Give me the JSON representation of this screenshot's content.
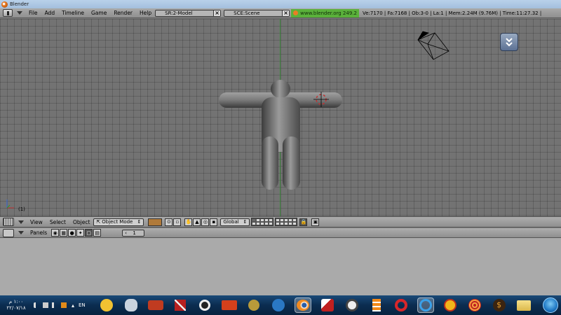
{
  "window": {
    "title": "Blender"
  },
  "info_header": {
    "menus": [
      "File",
      "Add",
      "Timeline",
      "Game",
      "Render",
      "Help"
    ],
    "screen_field": "SR:2-Model",
    "scene_field": "SCE:Scene",
    "url": "www.blender.org 249.2",
    "stats": "Ve:7170 | Fa:7168 | Ob:3-0 | La:1 | Mem:2.24M (9.76M) | Time:11:27.32 |"
  },
  "viewport": {
    "frame": "(1)",
    "grid_color": "#737373",
    "model_color": "#6e6e6e"
  },
  "view_header": {
    "menus": [
      "View",
      "Select",
      "Object"
    ],
    "mode": "Object Mode",
    "orientation": "Global"
  },
  "buttons_header": {
    "label": "Panels",
    "page": "1"
  },
  "taskbar": {
    "time": "١:٠٠ م",
    "date": "٢٢/٠٧/١٨",
    "language": "EN",
    "apps": [
      "pidgin-icon",
      "cat-icon",
      "street-racer-icon",
      "tool-icon",
      "ring-icon",
      "red-game-icon",
      "bug-icon",
      "globe-icon",
      "blender-icon",
      "rocket-icon",
      "ball-icon",
      "stack-icon",
      "lifebuoy-icon",
      "ie-icon",
      "face-icon",
      "spiral-icon",
      "money-icon",
      "folder-icon"
    ]
  }
}
